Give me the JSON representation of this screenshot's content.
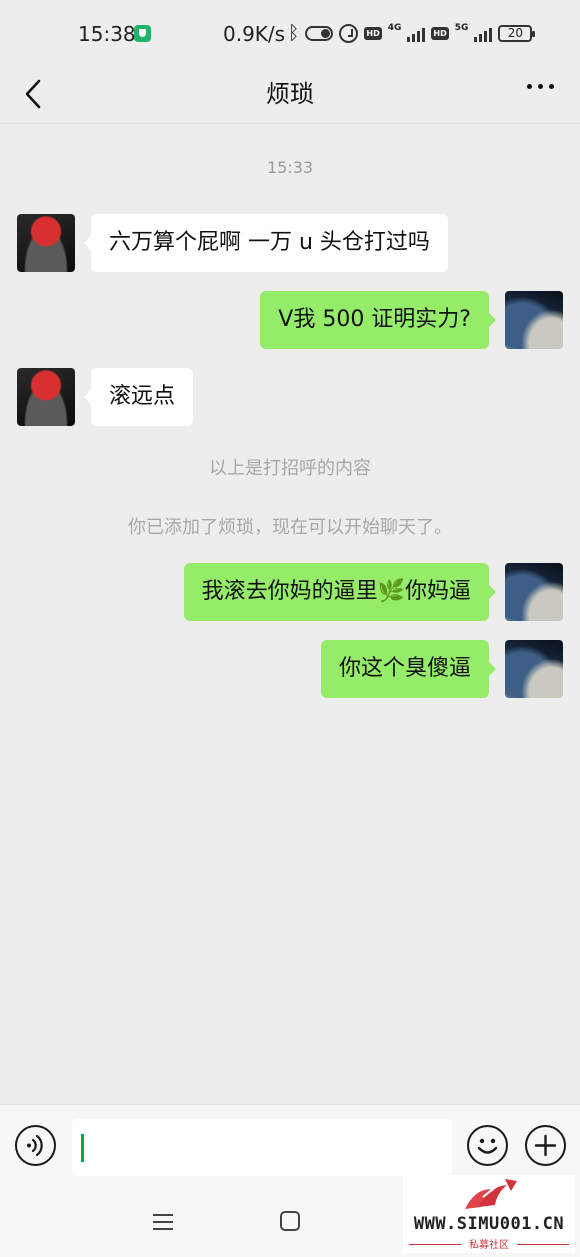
{
  "status_bar": {
    "time": "15:38",
    "network_speed": "0.9K/s",
    "hd_label": "HD",
    "net_4g": "4G",
    "net_5g": "5G",
    "battery": "20"
  },
  "header": {
    "title": "烦琐"
  },
  "chat": {
    "timestamp": "15:33",
    "messages": [
      {
        "side": "left",
        "text": "六万算个屁啊 一万 u 头仓打过吗"
      },
      {
        "side": "right",
        "text": "V我 500 证明实力?"
      },
      {
        "side": "left",
        "text": "滚远点"
      },
      {
        "side": "right",
        "text": "我滚去你妈的逼里🌿你妈逼"
      },
      {
        "side": "right",
        "text": "你这个臭傻逼"
      }
    ],
    "greeting_note": "以上是打招呼的内容",
    "added_note": "你已添加了烦琐，现在可以开始聊天了。"
  },
  "input": {
    "value": ""
  },
  "watermark": {
    "site": "WWW.SIMU001.CN",
    "subtitle": "私募社区"
  },
  "colors": {
    "background": "#ededed",
    "bubble_self": "#95ec69",
    "bubble_other": "#ffffff",
    "caret": "#08a84f",
    "watermark_accent": "#d2333b"
  },
  "icons": [
    "shield-icon",
    "bluetooth-icon",
    "toggle-icon",
    "alarm-icon",
    "signal-icon",
    "battery-icon",
    "back-arrow-icon",
    "more-icon",
    "voice-icon",
    "emoji-icon",
    "plus-icon",
    "menu-icon",
    "home-icon"
  ]
}
